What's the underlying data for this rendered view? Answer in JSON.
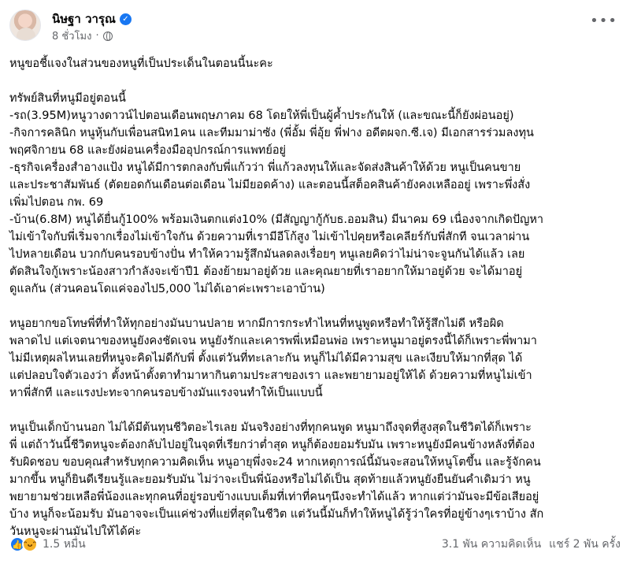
{
  "author": {
    "name": "นิษฐา วารุณ",
    "time": "8 ชั่วโมง",
    "verified_icon": "verified-badge-icon",
    "privacy_icon": "globe-icon"
  },
  "post": {
    "intro": "หนูขอชี้แจงในส่วนของหนูที่เป็นประเด็นในตอนนี้นะคะ",
    "assets": [
      "ทรัพย์สินที่หนูมีอยู่ตอนนี้",
      "-รถ(3.95M)หนูวางดาวน์ไปตอนเดือนพฤษภาคม 68 โดยให้พี่เป็นผู้ค้ำประกันให้ (และขณะนี้ก็ยังผ่อนอยู่)",
      "-กิจการคลินิก หนูหุ้นกับเพื่อนสนิท1คน และทีมมาม่าซัง (พี่อั้ม พี่อุ้ย พี่ฟาง อดีตผจก.ซี.เจ) มีเอกสารร่วมลงทุน",
      "พฤศจิกายน 68 และยังผ่อนเครื่องมืออุปกรณ์การแพทย์อยู่",
      "-ธุรกิจเครื่องสำอางแป้ง หนูได้มีการตกลงกับพี่แก้วว่า พี่แก้วลงทุนให้และจัดส่งสินค้าให้ด้วย หนูเป็นคนขาย",
      "และประชาสัมพันธ์ (ตัดยอดกันเดือนต่อเดือน ไม่มียอดค้าง) และตอนนี้สต็อคสินค้ายังคงเหลืออยู่ เพราะพึ่งสั่ง",
      "เพิ่มไปตอน กพ. 69",
      "-บ้าน(6.8M) หนูได้ยื่นกู้100% พร้อมเงินตกแต่ง10% (มีสัญญากู้กับธ.ออมสิน) มีนาคม 69 เนื่องจากเกิดปัญหา",
      "ไม่เข้าใจกับพี่เริ่มจากเรื่องไม่เข้าใจกัน ด้วยความที่เรามีอีโก้สูง ไม่เข้าไปคุยหรือเคลียร์กับพี่สักที จนเวลาผ่าน",
      "ไปหลายเดือน บวกกับคนรอบข้างปั่น ทำให้ความรู้สึกมันลดลงเรื่อยๆ หนูเลยคิดว่าไม่น่าจะจูนกันได้แล้ว เลย",
      "ตัดสินใจกู้เพราะน้องสาวกำลังจะเข้าปี1 ต้องย้ายมาอยู่ด้วย และคุณยายที่เราอยากให้มาอยู่ด้วย จะได้มาอยู่",
      "ดูแลกัน (ส่วนคอนโดแค่จองไป5,000 ไม่ได้เอาค่ะเพราะเอาบ้าน)"
    ],
    "apology": [
      "หนูอยากขอโทษพี่ที่ทำให้ทุกอย่างมันบานปลาย หากมีการกระทำไหนที่หนูพูดหรือทำให้รู้สึกไม่ดี หรือผิด",
      "พลาดไป แต่เจตนาของหนูยังคงชัดเจน หนูยังรักและเคารพพี่เหมือนพ่อ เพราะหนูมาอยู่ตรงนี้ได้ก็เพราะพี่พามา",
      "ไม่มีเหตุผลไหนเลยที่หนูจะคิดไม่ดีกับพี่ ตั้งแต่วันที่ทะเลาะกัน หนูก็ไม่ได้มีความสุข และเงียบให้มากที่สุด ได้",
      "แต่ปลอบใจตัวเองว่า ตั้งหน้าตั้งตาทำมาหากินตามประสาของเรา และพยายามอยู่ให้ได้ ด้วยความที่หนูไม่เข้า",
      "หาพี่สักที และแรงปะทะจากคนรอบข้างมันแรงจนทำให้เป็นแบบนี้"
    ],
    "closing": [
      "หนูเป็นเด็กบ้านนอก ไม่ได้มีต้นทุนชีวิตอะไรเลย มันจริงอย่างที่ทุกคนพูด หนูมาถึงจุดที่สูงสุดในชีวิตได้ก็เพราะ",
      "พี่ แต่ถ้าวันนี้ชีวิตหนูจะต้องกลับไปอยู่ในจุดที่เรียกว่าต่ำสุด หนูก็ต้องยอมรับมัน เพราะหนูยังมีคนข้างหลังที่ต้อง",
      "รับผิดชอบ ขอบคุณสำหรับทุกความคิดเห็น หนูอายุพึ่งจะ24 หากเหตุการณ์นี้มันจะสอนให้หนูโตขึ้น และรู้จักคน",
      "มากขึ้น หนูก็ยินดีเรียนรู้และยอมรับมัน ไม่ว่าจะเป็นพี่น้องหรือไม่ได้เป็น สุดท้ายแล้วหนูยังยืนยันคำเดิมว่า หนู",
      "พยายามช่วยเหลือพี่น้องและทุกคนที่อยู่รอบข้างแบบเต็มที่เท่าที่คนๆนึงจะทำได้แล้ว หากแต่ว่ามันจะมีข้อเสียอยู่",
      "บ้าง หนูก็จะน้อมรับ มันอาจจะเป็นแค่ช่วงที่แย่ที่สุดในชีวิต แต่วันนี้มันก็ทำให้หนูได้รู้ว่าใครที่อยู่ข้างๆเราบ้าง สัก",
      "วันหนูจะผ่านมันไปให้ได้ค่ะ"
    ]
  },
  "footer": {
    "reaction_count": "1.5 หมื่น",
    "comments": "3.1 พัน ความคิดเห็น",
    "shares": "แชร์ 2 พัน ครั้ง"
  },
  "colors": {
    "text": "#050505",
    "secondary": "#65676b",
    "like_blue": "#1877f2",
    "haha_yellow": "#f7b125"
  }
}
